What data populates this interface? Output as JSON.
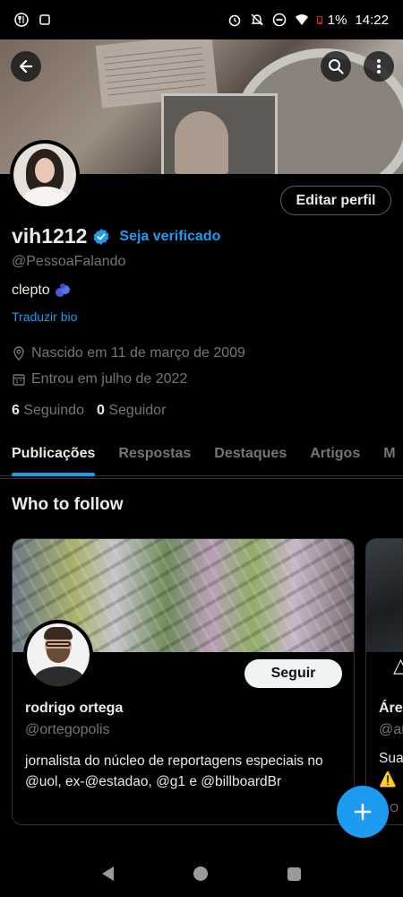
{
  "status_bar": {
    "battery": "1%",
    "time": "14:22"
  },
  "profile": {
    "display_name": "vih1212",
    "verify_link": "Seja verificado",
    "handle": "@PessoaFalando",
    "bio": "clepto",
    "translate_bio": "Traduzir bio",
    "birthday": "Nascido em 11 de março de 2009",
    "joined": "Entrou em julho de 2022",
    "following_count": "6",
    "following_label": "Seguindo",
    "followers_count": "0",
    "followers_label": "Seguidor",
    "edit_profile_label": "Editar perfil"
  },
  "tabs": [
    {
      "label": "Publicações",
      "active": true
    },
    {
      "label": "Respostas",
      "active": false
    },
    {
      "label": "Destaques",
      "active": false
    },
    {
      "label": "Artigos",
      "active": false
    },
    {
      "label": "M",
      "active": false
    }
  ],
  "who_to_follow": {
    "title": "Who to follow",
    "cards": [
      {
        "name": "rodrigo ortega",
        "handle": "@ortegopolis",
        "bio": "jornalista do núcleo de reportagens especiais no @uol, ex-@estadao, @g1 e @billboardBr",
        "follow_label": "Seguir"
      },
      {
        "name": "Áre",
        "handle": "@ar",
        "bio": "Sua",
        "warning_icon": "⚠️",
        "footer": "O"
      }
    ]
  },
  "colors": {
    "accent": "#1d9bf0",
    "background": "#000000",
    "muted_text": "#71767b",
    "primary_text": "#e7e9ea"
  },
  "icons": [
    "back-arrow-icon",
    "search-icon",
    "more-vertical-icon",
    "verified-badge-icon",
    "location-icon",
    "calendar-icon",
    "compose-plus-icon"
  ]
}
